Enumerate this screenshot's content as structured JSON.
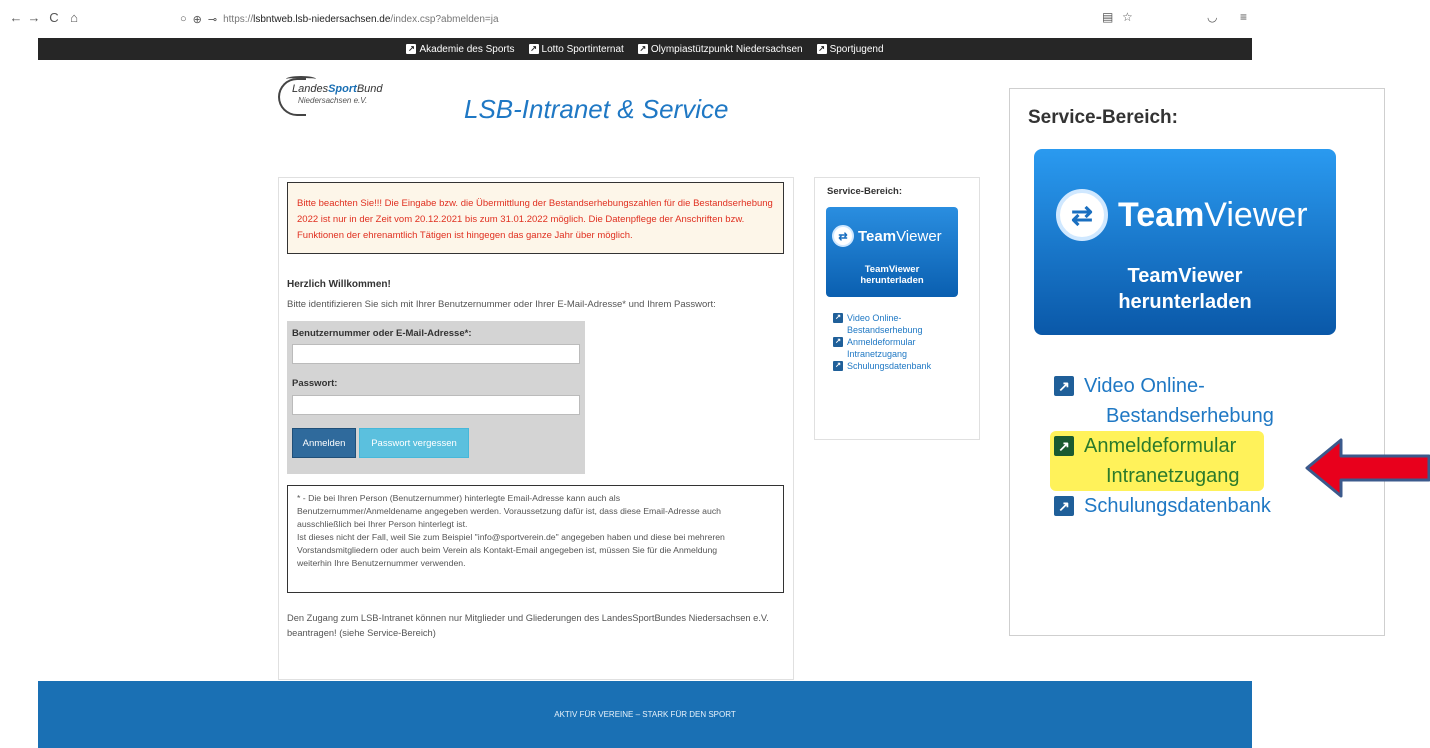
{
  "browser": {
    "back_icon": "←",
    "forward_icon": "→",
    "reload_icon": "C",
    "home_icon": "⌂",
    "url_prefix": "https://",
    "url_host": "lsbntweb.lsb-niedersachsen.de",
    "url_path": "/index.csp?abmelden=ja"
  },
  "topnav": {
    "items": [
      "Akademie des Sports",
      "Lotto Sportinternat",
      "Olympiastützpunkt Niedersachsen",
      "Sportjugend"
    ]
  },
  "logo": {
    "part1": "Landes",
    "part2": "Sport",
    "part3": "Bund",
    "line2": "Niedersachsen e.V."
  },
  "site_title": "LSB-Intranet & Service",
  "notice": "Bitte beachten Sie!!! Die Eingabe bzw. die Übermittlung der Bestandserhebungszahlen für die Bestandserhebung 2022 ist nur in der Zeit vom 20.12.2021 bis zum 31.01.2022 möglich. Die Datenpflege der Anschriften bzw. Funktionen der ehrenamtlich Tätigen ist hingegen das ganze Jahr über möglich.",
  "welcome": {
    "heading": "Herzlich Willkommen!",
    "text": "Bitte identifizieren Sie sich mit Ihrer Benutzernummer oder Ihrer E-Mail-Adresse* und Ihrem Passwort:"
  },
  "login": {
    "user_label": "Benutzernummer oder E-Mail-Adresse*:",
    "user_value": "",
    "password_label": "Passwort:",
    "password_value": "",
    "login_button": "Anmelden",
    "forgot_button": "Passwort vergessen"
  },
  "footnote": {
    "lines": [
      "* - Die bei Ihren Person (Benutzernummer) hinterlegte Email-Adresse kann auch als",
      "Benutzernummer/Anmeldename angegeben werden. Voraussetzung dafür ist, dass diese Email-Adresse auch",
      "ausschließlich bei Ihrer Person hinterlegt ist.",
      "Ist dieses nicht der Fall, weil Sie zum Beispiel \"info@sportverein.de\" angegeben haben und diese bei mehreren",
      "Vorstandsmitgliedern oder auch beim Verein als Kontakt-Email angegeben ist, müssen Sie für die Anmeldung",
      "weiterhin Ihre Benutzernummer verwenden."
    ]
  },
  "access_text": "Den Zugang zum LSB-Intranet können nur Mitglieder und Gliederungen des LandesSportBundes Niedersachsen e.V. beantragen! (siehe Service-Bereich)",
  "service": {
    "heading": "Service-Bereich:",
    "teamviewer_name_bold": "Team",
    "teamviewer_name_light": "Viewer",
    "teamviewer_download_line1": "TeamViewer",
    "teamviewer_download_line2": "herunterladen",
    "links": [
      {
        "line1": "Video Online-",
        "line2": "Bestandserhebung"
      },
      {
        "line1": "Anmeldeformular",
        "line2": "Intranetzugang"
      },
      {
        "line1": "Schulungsdatenbank",
        "line2": ""
      }
    ]
  },
  "footer_text": "AKTIV FÜR VEREINE – STARK FÜR DEN SPORT",
  "colors": {
    "accent": "#1f78c4",
    "footer": "#1a70b4",
    "highlight": "#fff25a",
    "arrow": "#e8001c"
  }
}
